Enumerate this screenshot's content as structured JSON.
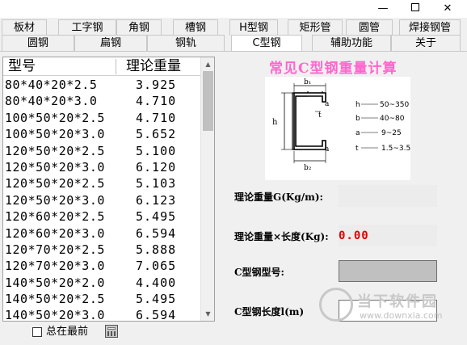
{
  "window": {
    "minimize_glyph": "—",
    "close_glyph": "✕"
  },
  "tabs": {
    "row1": [
      "板材",
      "工字钢",
      "角钢",
      "槽钢",
      "H型钢",
      "矩形管",
      "圆管",
      "焊接钢管"
    ],
    "row2": [
      "圆钢",
      "扁钢",
      "钢轨",
      "C型钢",
      "辅助功能",
      "关于"
    ],
    "active": "C型钢"
  },
  "list": {
    "headers": {
      "type": "型号",
      "weight": "理论重量"
    },
    "rows": [
      {
        "type": "80*40*20*2.5",
        "weight": "3.925"
      },
      {
        "type": "80*40*20*3.0",
        "weight": "4.710"
      },
      {
        "type": "100*50*20*2.5",
        "weight": "4.710"
      },
      {
        "type": "100*50*20*3.0",
        "weight": "5.652"
      },
      {
        "type": "120*50*20*2.5",
        "weight": "5.100"
      },
      {
        "type": "120*50*20*3.0",
        "weight": "6.120"
      },
      {
        "type": "120*50*20*2.5",
        "weight": "5.103"
      },
      {
        "type": "120*50*20*3.0",
        "weight": "6.123"
      },
      {
        "type": "120*60*20*2.5",
        "weight": "5.495"
      },
      {
        "type": "120*60*20*3.0",
        "weight": "6.594"
      },
      {
        "type": "120*70*20*2.5",
        "weight": "5.888"
      },
      {
        "type": "120*70*20*3.0",
        "weight": "7.065"
      },
      {
        "type": "140*50*20*2.0",
        "weight": "4.400"
      },
      {
        "type": "140*50*20*2.5",
        "weight": "5.495"
      },
      {
        "type": "140*50*20*3.0",
        "weight": "6.594"
      }
    ]
  },
  "footer": {
    "always_on_top_label": "总在最前",
    "always_on_top_checked": false
  },
  "calculator": {
    "title": "常见C型钢重量计算",
    "diagram": {
      "label_b1": "b₁",
      "label_b2": "b₂",
      "label_h": "h",
      "label_a_top": "a",
      "label_a_bottom": "a",
      "label_t": "t",
      "ranges": [
        {
          "name": "h",
          "range": "50~350"
        },
        {
          "name": "b",
          "range": "40~80"
        },
        {
          "name": "a",
          "range": "9~25"
        },
        {
          "name": "t",
          "range": "1.5~3.5"
        }
      ]
    },
    "unit_weight_label": "理论重量G(Kg/m):",
    "unit_weight_value": "",
    "total_weight_label": "理论重量×长度(Kg):",
    "total_weight_value": "0.00",
    "model_label": "C型钢型号:",
    "model_value": "",
    "length_label": "C型钢长度l(m)",
    "length_value": ""
  },
  "watermark": {
    "text": "当下软件园",
    "url": "www.downxia.com"
  }
}
